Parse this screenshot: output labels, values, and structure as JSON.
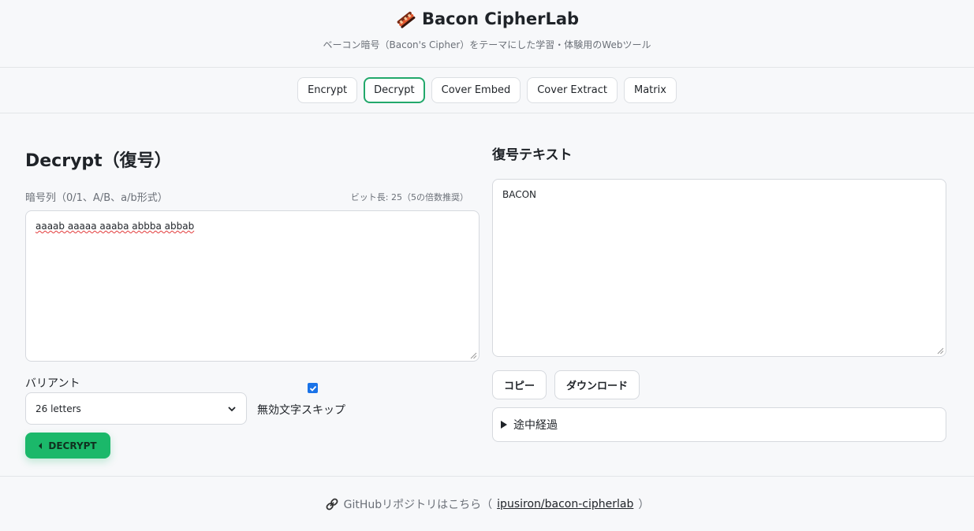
{
  "app": {
    "title": "Bacon CipherLab",
    "subtitle": "ベーコン暗号（Bacon's Cipher）をテーマにした学習・体験用のWebツール",
    "logo_icon": "bacon-icon"
  },
  "tabs": [
    {
      "label": "Encrypt",
      "active": false
    },
    {
      "label": "Decrypt",
      "active": true
    },
    {
      "label": "Cover Embed",
      "active": false
    },
    {
      "label": "Cover Extract",
      "active": false
    },
    {
      "label": "Matrix",
      "active": false
    }
  ],
  "decrypt": {
    "title": "Decrypt（復号）",
    "input_label": "暗号列（0/1、A/B、a/b形式）",
    "bit_length": "ビット長: 25（5の倍数推奨）",
    "input_value": "aaaab aaaaa aaaba abbba abbab",
    "variant_label": "バリアント",
    "variant_value": "26 letters",
    "skip_checked": true,
    "skip_label": "無効文字スキップ",
    "button_label": "DECRYPT"
  },
  "result": {
    "title": "復号テキスト",
    "value": "BACON",
    "copy_label": "コピー",
    "download_label": "ダウンロード",
    "details_label": "途中経過"
  },
  "footer": {
    "prefix": "GitHubリポジトリはこちら（",
    "link_text": "ipusiron/bacon-cipherlab",
    "suffix": "）"
  },
  "colors": {
    "accent": "#1bb86a",
    "active_tab_border": "#22a86b",
    "checkbox": "#1a73e8"
  }
}
